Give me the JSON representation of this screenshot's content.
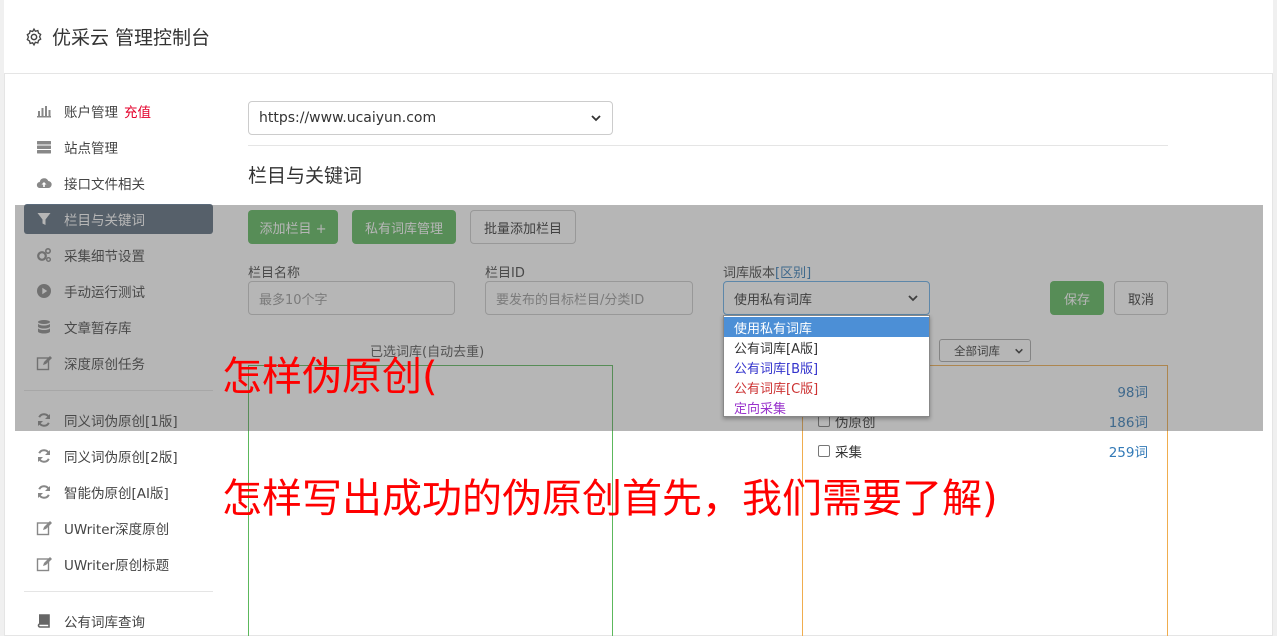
{
  "header": {
    "title": "优采云 管理控制台",
    "icon": "gear-icon"
  },
  "sidebar": {
    "group1": [
      {
        "label": "账户管理",
        "extra": "充值",
        "icon": "bar-chart-icon"
      },
      {
        "label": "站点管理",
        "icon": "server-icon"
      },
      {
        "label": "接口文件相关",
        "icon": "cloud-upload-icon"
      },
      {
        "label": "栏目与关键词",
        "icon": "filter-icon",
        "active": true
      },
      {
        "label": "采集细节设置",
        "icon": "cogs-icon"
      },
      {
        "label": "手动运行测试",
        "icon": "play-circle-icon"
      },
      {
        "label": "文章暂存库",
        "icon": "database-icon"
      },
      {
        "label": "深度原创任务",
        "icon": "edit-icon"
      }
    ],
    "group2": [
      {
        "label": "同义词伪原创[1版]",
        "icon": "refresh-icon"
      },
      {
        "label": "同义词伪原创[2版]",
        "icon": "refresh-icon"
      },
      {
        "label": "智能伪原创[AI版]",
        "icon": "refresh-icon"
      },
      {
        "label": "UWriter深度原创",
        "icon": "edit-icon"
      },
      {
        "label": "UWriter原创标题",
        "icon": "edit-icon"
      }
    ],
    "group3": [
      {
        "label": "公有词库查询",
        "icon": "book-icon"
      }
    ]
  },
  "main": {
    "site_select": "https://www.ucaiyun.com",
    "section_title": "栏目与关键词",
    "buttons": {
      "add_column": "添加栏目 +",
      "private_lib": "私有词库管理",
      "batch_add": "批量添加栏目",
      "save": "保存",
      "cancel": "取消"
    },
    "form": {
      "name_label": "栏目名称",
      "name_placeholder": "最多10个字",
      "id_label": "栏目ID",
      "id_placeholder": "要发布的目标栏目/分类ID",
      "version_label": "词库版本",
      "version_link": "[区别]",
      "version_value": "使用私有词库"
    },
    "dropdown_options": [
      {
        "label": "使用私有词库",
        "color": "#ffffff"
      },
      {
        "label": "公有词库[A版]",
        "color": "#333333"
      },
      {
        "label": "公有词库[B版]",
        "color": "#3333cc"
      },
      {
        "label": "公有词库[C版]",
        "color": "#cc3333"
      },
      {
        "label": "定向采集",
        "color": "#9933cc"
      }
    ],
    "selected_heading": "已选词库(自动去重)",
    "lib_filter": "全部词库",
    "libraries": [
      {
        "label": "",
        "count": "98词"
      },
      {
        "label": "伪原创",
        "count": "186词"
      },
      {
        "label": "采集",
        "count": "259词"
      }
    ]
  },
  "overlay_text": {
    "line1": "怎样伪原创(",
    "line2": "怎样写出成功的伪原创首先，我们需要了解)"
  },
  "colors": {
    "accent_green": "#5cb85c",
    "active_nav": "#5b6b7c",
    "recharge": "#e4002b",
    "overlay_text": "#ff0000"
  }
}
